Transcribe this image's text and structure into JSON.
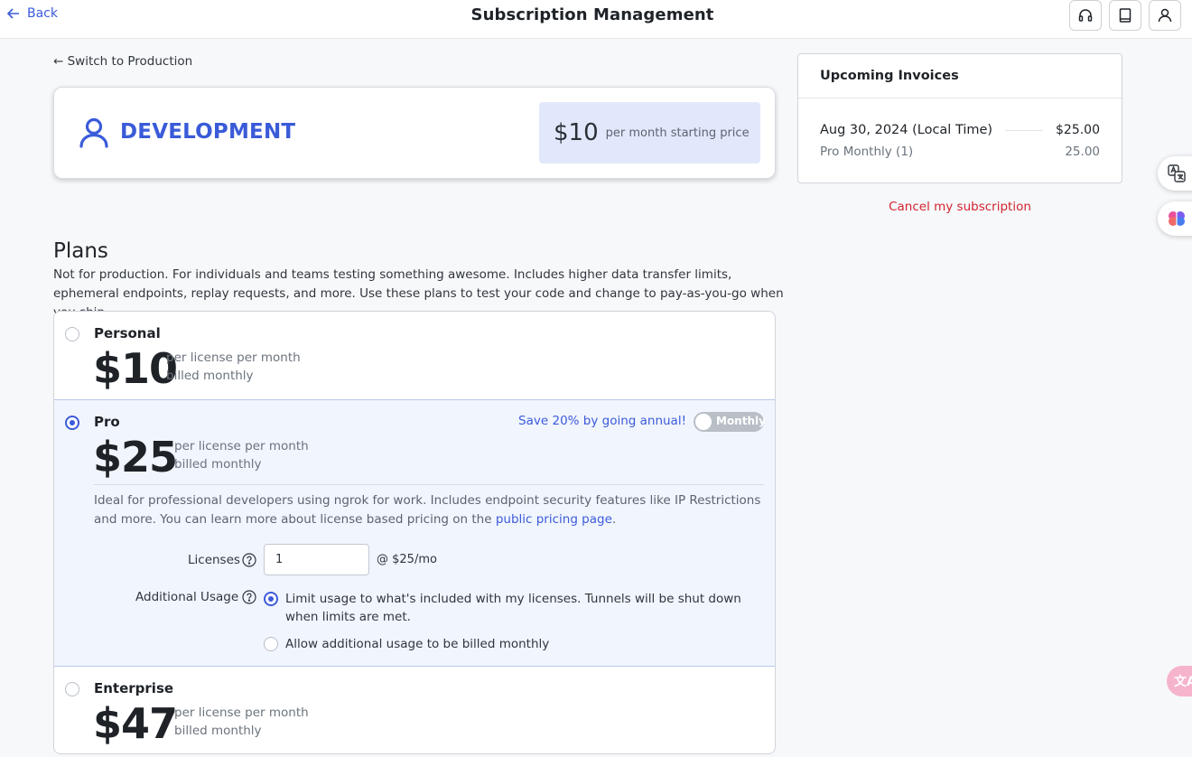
{
  "header": {
    "back_label": "Back",
    "title": "Subscription Management",
    "icons": [
      "headset-icon",
      "book-icon",
      "user-icon"
    ]
  },
  "switch_link": "← Switch to Production",
  "environment": {
    "name": "DEVELOPMENT",
    "price": "$10",
    "price_note": "per month starting price",
    "accent_color": "#3a5bd8"
  },
  "invoices": {
    "title": "Upcoming Invoices",
    "items": [
      {
        "date": "Aug 30, 2024 (Local Time)",
        "amount": "$25.00",
        "line_label": "Pro Monthly (1)",
        "line_amount": "25.00"
      }
    ],
    "cancel_label": "Cancel my subscription"
  },
  "plans": {
    "title": "Plans",
    "description": "Not for production. For individuals and teams testing something awesome. Includes higher data transfer limits, ephemeral endpoints, replay requests, and more. Use these plans to test your code and change to pay-as-you-go when you ship.",
    "items": [
      {
        "name": "Personal",
        "price": "$10",
        "unit_line1": "per license per month",
        "unit_line2": "billed monthly",
        "selected": false
      },
      {
        "name": "Pro",
        "price": "$25",
        "unit_line1": "per license per month",
        "unit_line2": "billed monthly",
        "selected": true
      },
      {
        "name": "Enterprise",
        "price": "$47",
        "unit_line1": "per license per month",
        "unit_line2": "billed monthly",
        "selected": false
      }
    ],
    "pro": {
      "save_text": "Save 20% by going annual!",
      "toggle_label": "Monthly",
      "desc_text": "Ideal for professional developers using ngrok for work. Includes endpoint security features like IP Restrictions and more. You can learn more about license based pricing on the ",
      "desc_link": "public pricing page",
      "desc_end": ".",
      "licenses_label": "Licenses",
      "licenses_value": "1",
      "licenses_rate": "@ $25/mo",
      "usage_label": "Additional Usage",
      "usage_options": [
        {
          "label": "Limit usage to what's included with my licenses. Tunnels will be shut down when limits are met.",
          "selected": true
        },
        {
          "label": "Allow additional usage to be billed monthly",
          "selected": false
        }
      ]
    }
  },
  "colors": {
    "primary": "#3b5bdb",
    "danger": "#d1242f",
    "selected_bg": "#f1f5fd"
  }
}
